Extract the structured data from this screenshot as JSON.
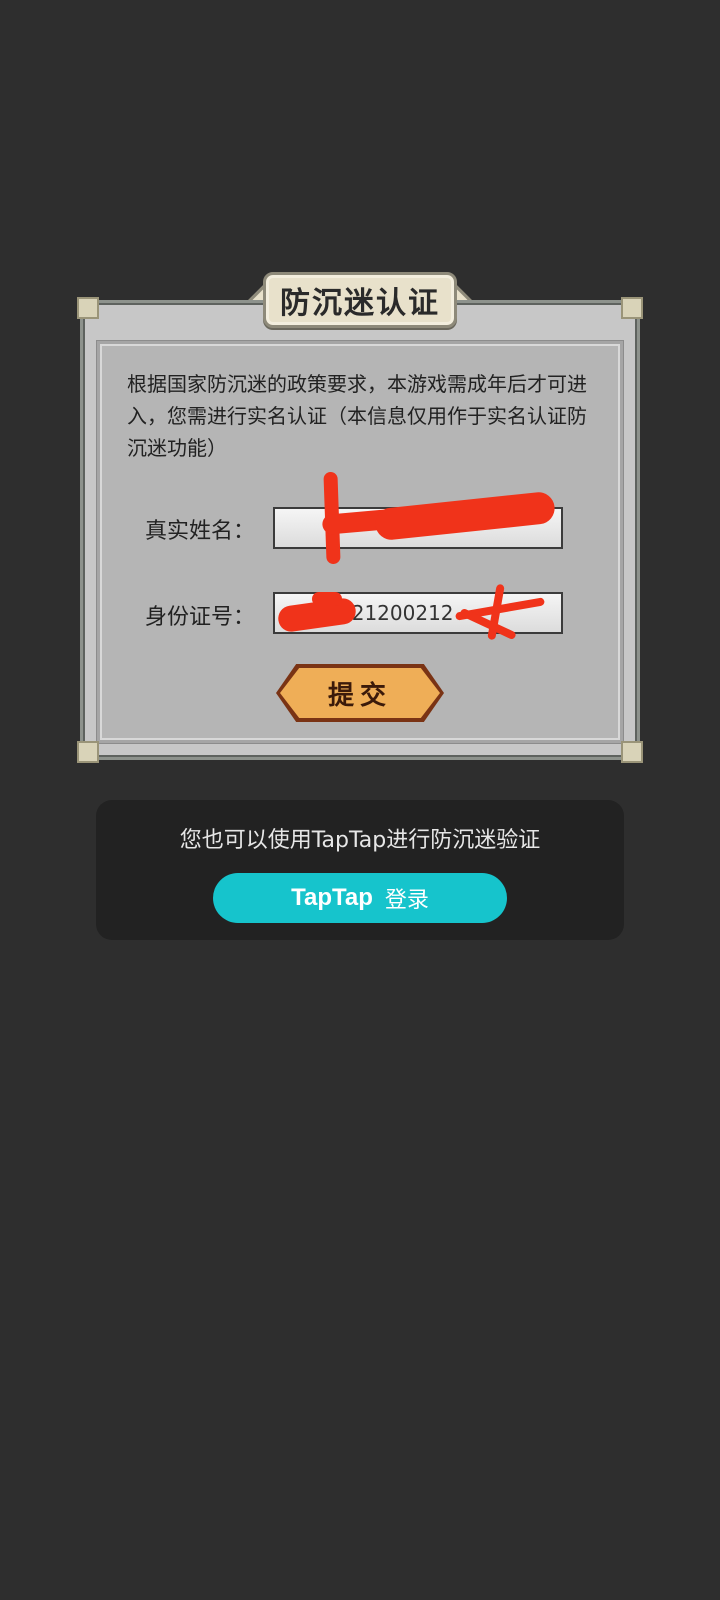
{
  "dialog": {
    "title": "防沉迷认证",
    "notice": "根据国家防沉迷的政策要求，本游戏需成年后才可进入，您需进行实名认证（本信息仅用作于实名认证防沉迷功能）",
    "name_label": "真实姓名：",
    "name_value": "",
    "id_label": "身份证号：",
    "id_value": "321200212",
    "submit_label": "提交"
  },
  "taptap": {
    "prompt": "您也可以使用TapTap进行防沉迷验证",
    "logo_text": "TapTap",
    "login_label": "登录",
    "button_color": "#16c4cc"
  },
  "colors": {
    "background": "#2e2e2e",
    "redaction": "#f0331a",
    "submit_fill": "#efae57"
  }
}
